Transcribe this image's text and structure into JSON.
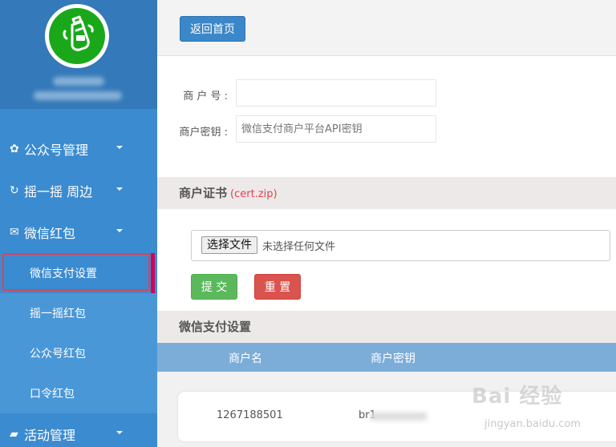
{
  "sidebar": {
    "profile": {
      "avatar_label": "WeChat bottle avatar"
    },
    "nav": [
      {
        "icon": "gear-icon",
        "glyph": "✿",
        "label": "公众号管理"
      },
      {
        "icon": "refresh-icon",
        "glyph": "↻",
        "label": "摇一摇 周边"
      },
      {
        "icon": "envelope-icon",
        "glyph": "✉",
        "label": "微信红包"
      }
    ],
    "sub_items": [
      {
        "label": "微信支付设置",
        "active": true
      },
      {
        "label": "摇一摇红包"
      },
      {
        "label": "公众号红包"
      },
      {
        "label": "口令红包"
      }
    ],
    "nav_bottom": {
      "icon": "folder-icon",
      "glyph": "▰",
      "label": "活动管理"
    }
  },
  "toolbar": {
    "home_label": "返回首页"
  },
  "form": {
    "merchant_no": {
      "label": "商 户 号 :",
      "value": "",
      "placeholder": ""
    },
    "merchant_key": {
      "label": "商户密钥 :",
      "value": "",
      "placeholder": "微信支付商户平台API密钥"
    }
  },
  "cert_section": {
    "title": "商户证书",
    "hint": "(cert.zip)",
    "file_button": "选择文件",
    "file_status": "未选择任何文件",
    "submit_label": "提 交",
    "reset_label": "重 置"
  },
  "settings_section": {
    "title": "微信支付设置",
    "columns": [
      "商户名",
      "商户密钥"
    ],
    "rows": [
      {
        "merchant_name": "1267188501",
        "merchant_key": "br1"
      }
    ]
  },
  "watermark": {
    "main": "Bai 经验",
    "sub": "jingyan.baidu.com"
  },
  "colors": {
    "sidebar_bg": "#3b8bd0",
    "profile_bg": "#3479b9",
    "submenu_bg": "#4a97d8",
    "primary_btn": "#3a87c9",
    "success_btn": "#5cb85c",
    "danger_btn": "#d9534f",
    "highlight_red": "#e5404f",
    "table_head": "#7cadd9"
  }
}
